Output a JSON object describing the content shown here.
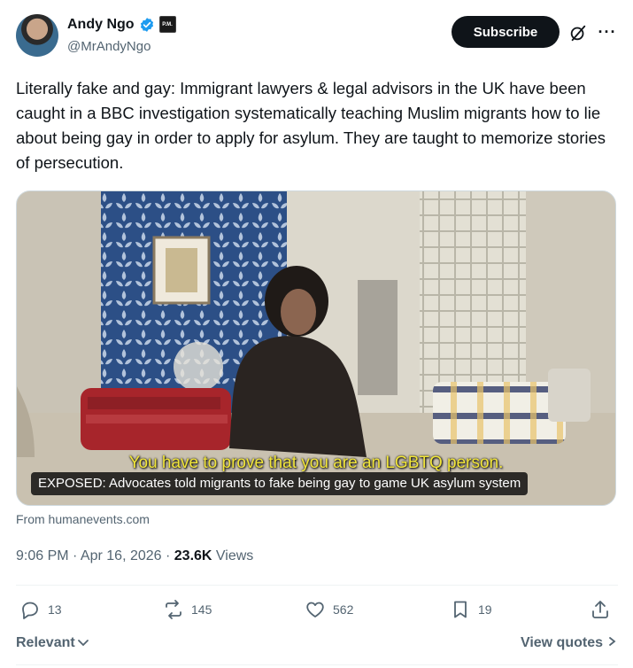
{
  "author": {
    "display_name": "Andy Ngo",
    "handle": "@MrAndyNgo",
    "affiliation_badge": "P.M."
  },
  "header": {
    "subscribe_label": "Subscribe",
    "grok_icon": "grok-icon",
    "more_icon": "more-icon"
  },
  "tweet": {
    "text": "Literally fake and gay: Immigrant lawyers & legal advisors in the UK have been caught in a BBC investigation systematically teaching Muslim migrants how to lie about being gay in order to apply for asylum. They are taught to memorize stories of persecution."
  },
  "media": {
    "subtitle": "You have to prove that you are an LGBTQ person.",
    "caption": "EXPOSED: Advocates told migrants to fake being gay to game UK asylum system",
    "source": "From humanevents.com"
  },
  "meta": {
    "time_date": "9:06 PM · Apr 16, 2026 · ",
    "views_count": "23.6K",
    "views_label": " Views"
  },
  "actions": {
    "replies": "13",
    "reposts": "145",
    "likes": "562",
    "bookmarks": "19"
  },
  "footer": {
    "relevant_label": "Relevant",
    "view_quotes_label": "View quotes"
  },
  "colors": {
    "accent": "#1d9bf0",
    "text_primary": "#0f1419",
    "text_secondary": "#536471",
    "subtitle_yellow": "#f2e63a"
  }
}
